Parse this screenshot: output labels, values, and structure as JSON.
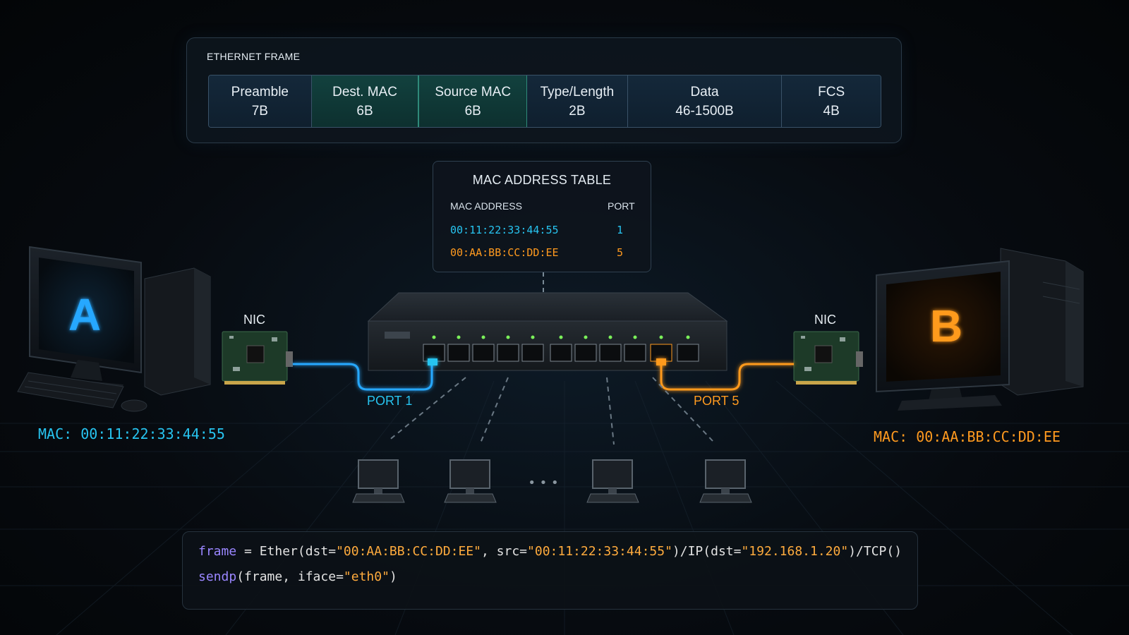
{
  "ethernet_frame": {
    "title": "ETHERNET FRAME",
    "fields": [
      {
        "name": "Preamble",
        "size": "7B"
      },
      {
        "name": "Dest. MAC",
        "size": "6B"
      },
      {
        "name": "Source MAC",
        "size": "6B"
      },
      {
        "name": "Type/Length",
        "size": "2B"
      },
      {
        "name": "Data",
        "size": "46-1500B"
      },
      {
        "name": "FCS",
        "size": "4B"
      }
    ]
  },
  "mac_table": {
    "title": "MAC ADDRESS TABLE",
    "col_mac": "MAC ADDRESS",
    "col_port": "PORT",
    "rows": [
      {
        "mac": "00:11:22:33:44:55",
        "port": "1"
      },
      {
        "mac": "00:AA:BB:CC:DD:EE",
        "port": "5"
      }
    ]
  },
  "host_a": {
    "letter": "A",
    "nic_label": "NIC",
    "mac_label": "MAC: 00:11:22:33:44:55",
    "port_label": "PORT 1"
  },
  "host_b": {
    "letter": "B",
    "nic_label": "NIC",
    "mac_label": "MAC: 00:AA:BB:CC:DD:EE",
    "port_label": "PORT 5"
  },
  "ellipsis": "• • •",
  "code": {
    "line1": {
      "var": "frame",
      "eq": " = Ether(dst=",
      "dst": "\"00:AA:BB:CC:DD:EE\"",
      "mid": ", src=",
      "src": "\"00:11:22:33:44:55\"",
      "mid2": ")/IP(dst=",
      "ip": "\"192.168.1.20\"",
      "end": ")/TCP()"
    },
    "line2": {
      "fn": "sendp",
      "args": "(frame, iface=",
      "iface": "\"eth0\"",
      "end": ")"
    }
  },
  "colors": {
    "host_a": "#27c4f0",
    "host_b": "#ff9a1f",
    "mac_field": "#12413e"
  }
}
